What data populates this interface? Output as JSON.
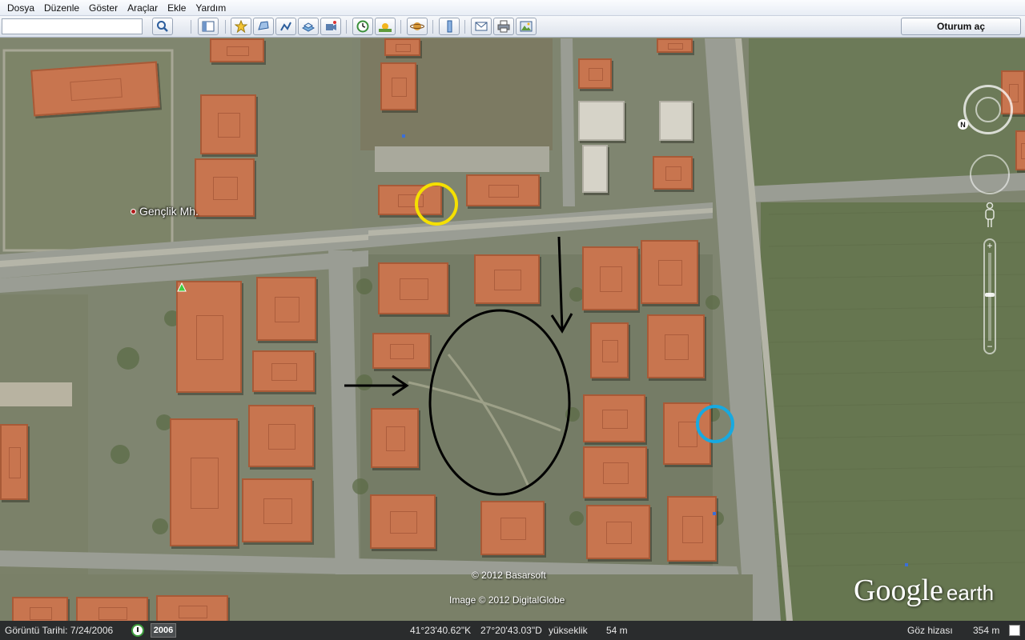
{
  "menu": [
    "Dosya",
    "Düzenle",
    "Göster",
    "Araçlar",
    "Ekle",
    "Yardım"
  ],
  "toolbar": {
    "search_value": "",
    "login_label": "Oturum aç",
    "icons": [
      "search-icon",
      "sidebar-toggle-icon",
      "placemark-icon",
      "polygon-icon",
      "path-icon",
      "image-overlay-icon",
      "record-tour-icon",
      "historical-imagery-icon",
      "sunlight-icon",
      "planets-icon",
      "ruler-icon",
      "email-icon",
      "print-icon",
      "save-image-icon"
    ]
  },
  "map": {
    "place_label": "Gençlik Mh.",
    "credit_basarsoft": "© 2012 Basarsoft",
    "credit_digitalglobe": "Image © 2012 DigitalGlobe",
    "brand_google": "Google",
    "brand_earth": "earth",
    "compass_north": "N",
    "zoom_level": 0.45,
    "annotation_colors": {
      "yellow_circle": "#f5e000",
      "blue_circle": "#18a9e0",
      "black_marks": "#000000"
    }
  },
  "status": {
    "imagery_date_label": "Görüntü Tarihi: 7/24/2006",
    "year": "2006",
    "latitude": "41°23'40.62\"K",
    "longitude": "27°20'43.03\"D",
    "elevation_label": "yükseklik",
    "elevation_value": "54 m",
    "eye_alt_label": "Göz hizası",
    "eye_alt_value": "354 m"
  }
}
